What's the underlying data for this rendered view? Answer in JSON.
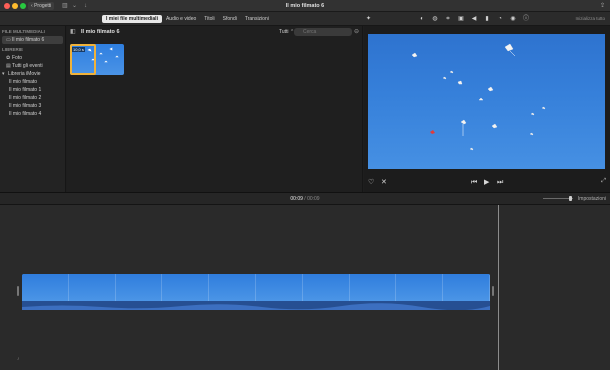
{
  "window": {
    "title": "Il mio filmato 6",
    "back_label": "Progetti",
    "back_icon": "chevron-left-icon",
    "share_icon": "share-icon"
  },
  "toolbar": {
    "tabs": [
      {
        "label": "I miei file multimediali",
        "active": true
      },
      {
        "label": "Audio e video",
        "active": false
      },
      {
        "label": "Titoli",
        "active": false
      },
      {
        "label": "Sfondi",
        "active": false
      },
      {
        "label": "Transizioni",
        "active": false
      }
    ],
    "magic_icon": "magic-wand-icon",
    "tools": [
      "color-balance-icon",
      "color-correction-icon",
      "crop-icon",
      "stabilization-icon",
      "volume-icon",
      "equalizer-icon",
      "speed-icon",
      "filter-icon",
      "info-icon"
    ],
    "settings_label": "Inizializza tutto"
  },
  "sidebar": {
    "section_media": "FILE MULTIMEDIALI",
    "project_item": "Il mio filmato 6",
    "section_libraries": "LIBRERIE",
    "photos_label": "Foto",
    "events_label": "Tutti gli eventi",
    "library_label": "Libreria iMovie",
    "library_items": [
      "Il mio filmato",
      "Il mio filmato 1",
      "Il mio filmato 2",
      "Il mio filmato 3",
      "Il mio filmato 4"
    ]
  },
  "browser": {
    "title": "Il mio filmato 6",
    "filter_value": "Tutti",
    "search_placeholder": "Cerca",
    "clip_duration": "10,0 s"
  },
  "viewer": {
    "controls": [
      "favorite-icon",
      "reject-icon",
      "skip-back-icon",
      "play-icon",
      "skip-forward-icon",
      "fullscreen-icon"
    ]
  },
  "timeline": {
    "current_time": "00:09",
    "separator": "/",
    "total_time": "00:09",
    "settings_label": "Impostazioni",
    "zoom_level": 0.85,
    "frame_count": 10
  },
  "colors": {
    "accent": "#f0b23a",
    "sky": "#2f73d0",
    "background": "#1e1e1e"
  }
}
